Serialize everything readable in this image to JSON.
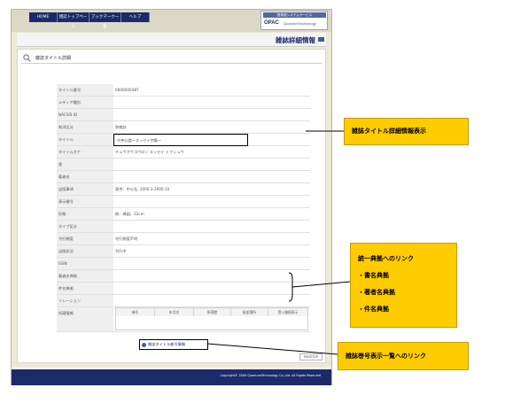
{
  "nav": {
    "tabs": [
      {
        "label": "HOME"
      },
      {
        "label": "雑誌トップページ"
      },
      {
        "label": "ブックマーク一覧"
      },
      {
        "label": "ヘルプ"
      }
    ]
  },
  "brand": {
    "tagline": "図書館システムサービス",
    "opac": "OPAC",
    "company": "QuantumTechnology"
  },
  "page_title": "雑誌詳細情報",
  "section_title": "雑誌タイトル詳細",
  "details": [
    {
      "label": "タイトル番号",
      "value": "0000000387"
    },
    {
      "label": "メディア種別",
      "value": ""
    },
    {
      "label": "NACSIS ID",
      "value": ""
    },
    {
      "label": "和洋区分",
      "value": "和雑誌"
    },
    {
      "label": "タイトル",
      "value": "中央公論ーエッセイ特集ー"
    },
    {
      "label": "タイトルカナ",
      "value": "チュウオウコウロン エッセイ トクシュウ"
    },
    {
      "label": "版",
      "value": ""
    },
    {
      "label": "著者名",
      "value": ""
    },
    {
      "label": "出版事項",
      "value": "東京：中公社, 2000.3-2000.10"
    },
    {
      "label": "表示番号",
      "value": ""
    },
    {
      "label": "形態",
      "value": "冊：挿図；22cm"
    },
    {
      "label": "タイプ区分",
      "value": ""
    },
    {
      "label": "刊行頻度",
      "value": "刊行頻度不明"
    },
    {
      "label": "出版状況",
      "value": "刊行中"
    },
    {
      "label": "ISSN",
      "value": ""
    },
    {
      "label": "著者名典拠",
      "value": ""
    },
    {
      "label": "件名典拠",
      "value": ""
    },
    {
      "label": "リレーション",
      "value": ""
    },
    {
      "label": "所蔵情報",
      "value": ""
    }
  ],
  "holdings_headers": [
    "巻号",
    "年月次",
    "所蔵館",
    "配架場所",
    "受入継続表示"
  ],
  "journal_link": "雑誌タイトル巻号情報",
  "pagetop": "PAGETOP",
  "copyright": "Copyright© 2009 QuantumTechnology Co.,Ltd. All Rights Reserved",
  "callouts": {
    "detail": "雑誌タイトル詳細情報表示",
    "links": [
      "統一典拠へのリンク",
      "・書名典拠",
      "・著者名典拠",
      "・件名典拠"
    ],
    "volume": "雑誌巻号表示一覧へのリンク"
  },
  "colors": {
    "navy": "#1c2a6b",
    "accent": "#3f5aa6",
    "callout": "#ffcc00"
  }
}
